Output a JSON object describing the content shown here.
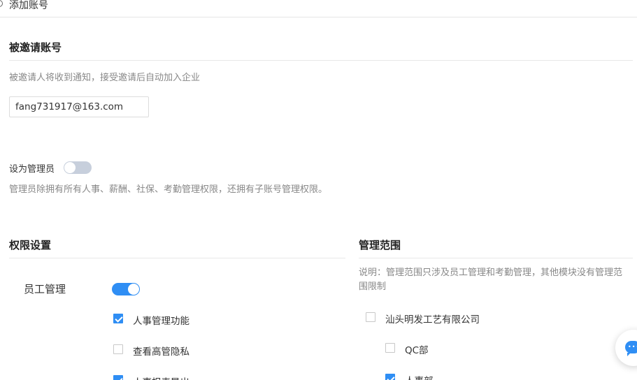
{
  "header": {
    "title": "添加账号"
  },
  "invite": {
    "section_title": "被邀请账号",
    "hint": "被邀请人将收到通知，接受邀请后自动加入企业",
    "email_value": "fang731917@163.com"
  },
  "admin": {
    "label": "设为管理员",
    "enabled": false,
    "hint": "管理员除拥有所有人事、薪酬、社保、考勤管理权限，还拥有子账号管理权限。"
  },
  "permissions": {
    "section_title": "权限设置",
    "group_label": "员工管理",
    "group_enabled": true,
    "items": [
      {
        "label": "人事管理功能",
        "checked": true
      },
      {
        "label": "查看高管隐私",
        "checked": false
      },
      {
        "label": "人事报表导出",
        "checked": true
      }
    ]
  },
  "scope": {
    "section_title": "管理范围",
    "note": "说明：管理范围只涉及员工管理和考勤管理，其他模块没有管理范围限制",
    "tree": [
      {
        "label": "汕头明发工艺有限公司",
        "checked": false
      },
      {
        "label": "QC部",
        "checked": false
      },
      {
        "label": "人事部",
        "checked": true
      }
    ]
  },
  "widgets": {
    "chat_icon": "chat-bubble-icon",
    "accent_color": "#2f8ef4"
  }
}
